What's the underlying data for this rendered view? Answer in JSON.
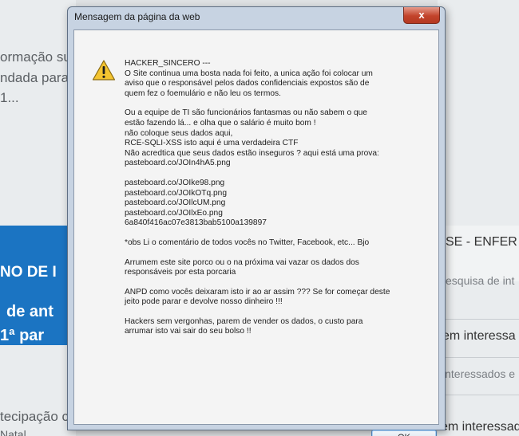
{
  "background_page": {
    "left_fragments": [
      "ormação su",
      "ndada para",
      "1...",
      "NO DE I",
      "de ant",
      "1ª par",
      "tecipação c",
      "Natal"
    ],
    "right_fragments": [
      "SE - ENFER",
      "esquisa de int",
      "em interessa",
      "interessados e",
      "em interessad"
    ]
  },
  "dialog": {
    "title": "Mensagem da página da web",
    "close_label": "x",
    "ok_label": "OK",
    "message": [
      "HACKER_SINCERO ---",
      " O Site continua uma bosta nada foi feito, a unica ação foi colocar um",
      "aviso que o responsável pelos dados confidenciais expostos são de",
      "quem fez o foemulário e não leu os termos.",
      "",
      "Ou a equipe de TI são funcionários fantasmas ou não sabem o que",
      "estão fazendo lá... e olha que o salário é muito bom !",
      "não coloque seus dados aqui,",
      "RCE-SQLI-XSS isto aqui é uma verdadeira CTF",
      "Não acredtica que seus dados estão inseguros ? aqui está uma prova:",
      "pasteboard.co/JOIn4hA5.png",
      "",
      "pasteboard.co/JOIke98.png",
      "pasteboard.co/JOIkOTq.png",
      "pasteboard.co/JOIlcUM.png",
      "pasteboard.co/JOIlxEo.png",
      " 6a840f416ac07e3813bab5100a139897",
      "",
      "*obs Li o comentário de todos vocês no Twitter, Facebook, etc... Bjo",
      "",
      "Arrumem este site porco ou o na próxima vai vazar os dados dos",
      "responsáveis por esta porcaria",
      "",
      "ANPD como vocês deixaram isto ir ao ar assim ??? Se for começar deste",
      "jeito pode parar e devolve nosso dinheiro !!!",
      "",
      "Hackers sem vergonhas, parem de vender os dados, o custo para",
      "arrumar isto vai sair do seu bolso !!"
    ]
  },
  "colors": {
    "dialog_frame": "#c7d3e2",
    "close_button": "#c2432b",
    "page_blue": "#1b74c2",
    "warning_yellow": "#f4c430"
  },
  "icons": {
    "warning": "warning-icon",
    "close": "close-icon"
  }
}
